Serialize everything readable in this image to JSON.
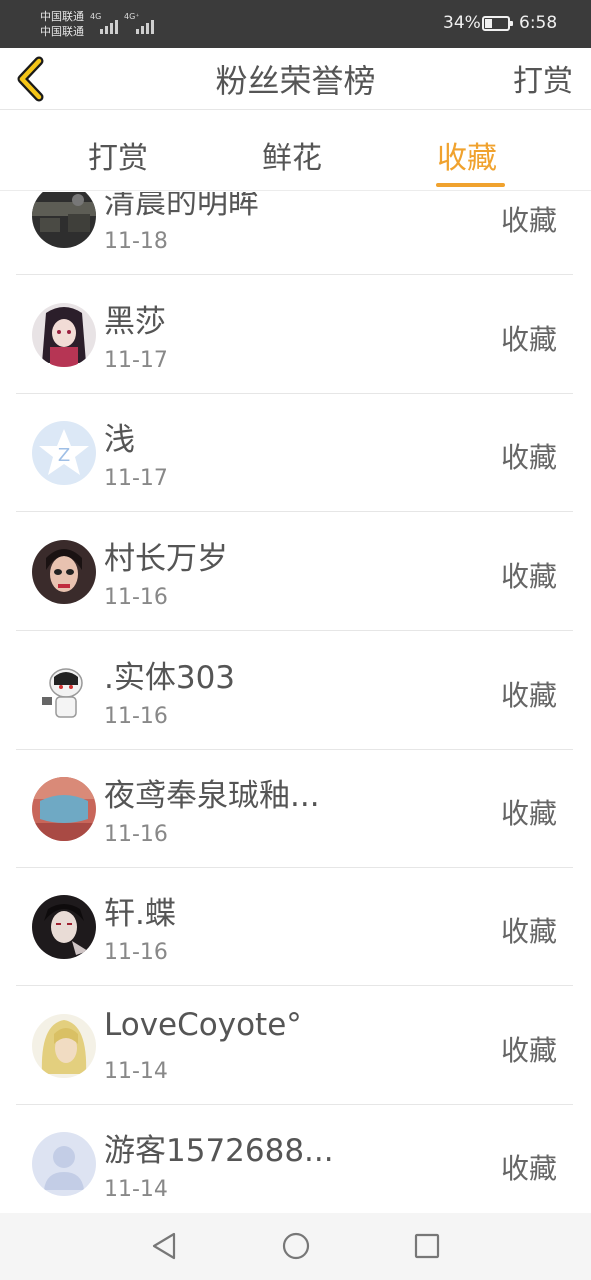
{
  "status_bar": {
    "carrier_1": "中国联通",
    "carrier_2": "中国联通",
    "network_1": "4G",
    "network_2": "4G⁺",
    "battery_percent": "34%",
    "battery_level": 0.34,
    "time": "6:58"
  },
  "header": {
    "title": "粉丝荣誉榜",
    "right_action": "打赏"
  },
  "tabs": [
    {
      "label": "打赏",
      "active": false
    },
    {
      "label": "鲜花",
      "active": false
    },
    {
      "label": "收藏",
      "active": true
    }
  ],
  "accent_color": "#f0a22e",
  "entries": [
    {
      "name": "清晨的明眸",
      "date": "11-18",
      "action": "收藏",
      "avatar": "dark-landscape-avatar"
    },
    {
      "name": "黑莎",
      "date": "11-17",
      "action": "收藏",
      "avatar": "anime-girl-avatar"
    },
    {
      "name": "浅",
      "date": "11-17",
      "action": "收藏",
      "avatar": "default-star-avatar"
    },
    {
      "name": "村长万岁",
      "date": "11-16",
      "action": "收藏",
      "avatar": "person-avatar"
    },
    {
      "name": ".实体303",
      "date": "11-16",
      "action": "收藏",
      "avatar": "chibi-avatar"
    },
    {
      "name": "夜鸢奉泉珹釉...",
      "date": "11-16",
      "action": "收藏",
      "avatar": "red-photo-avatar"
    },
    {
      "name": "轩.蝶",
      "date": "11-16",
      "action": "收藏",
      "avatar": "dark-anime-avatar"
    },
    {
      "name": "LoveCoyote°",
      "date": "11-14",
      "action": "收藏",
      "avatar": "blonde-anime-avatar"
    },
    {
      "name": "游客1572688...",
      "date": "11-14",
      "action": "收藏",
      "avatar": "default-user-avatar"
    }
  ],
  "nav": [
    "back-triangle-icon",
    "home-circle-icon",
    "recents-square-icon"
  ]
}
